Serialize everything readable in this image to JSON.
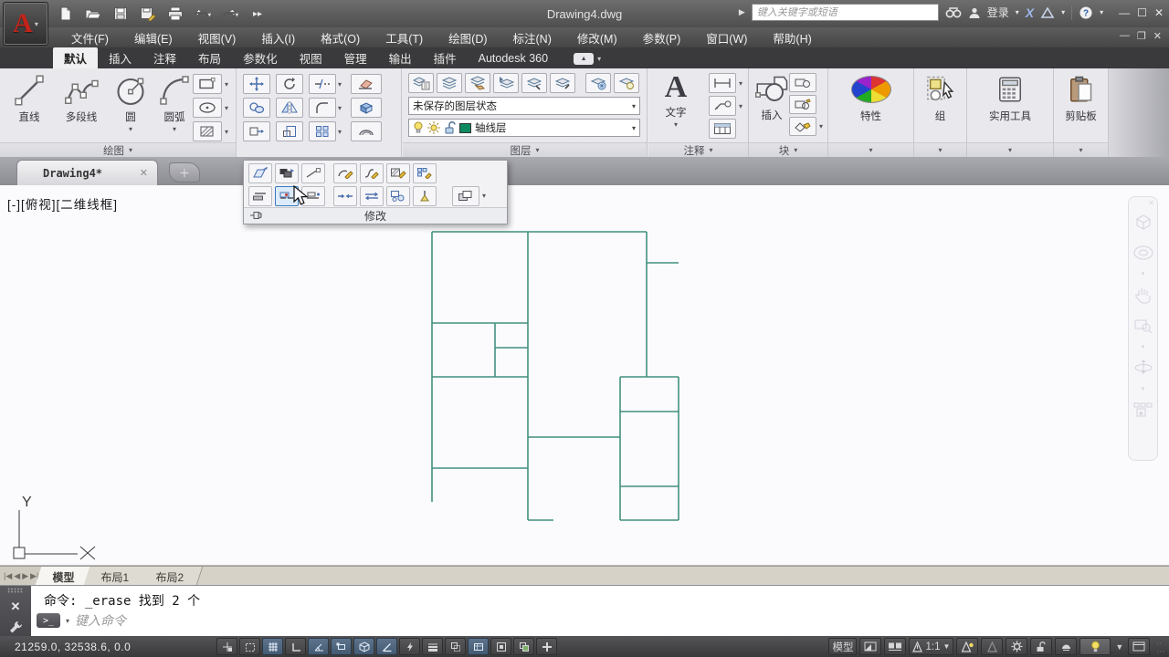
{
  "titlebar": {
    "title": "Drawing4.dwg",
    "search_placeholder": "键入关键字或短语",
    "signin_label": "登录",
    "quick_access_icons": [
      "new-file-icon",
      "open-file-icon",
      "save-icon",
      "save-as-icon",
      "plot-icon",
      "undo-icon",
      "redo-icon",
      "more-tools-icon"
    ],
    "window_controls": [
      "minimize",
      "maximize",
      "close"
    ]
  },
  "menubar": {
    "items": [
      "文件(F)",
      "编辑(E)",
      "视图(V)",
      "插入(I)",
      "格式(O)",
      "工具(T)",
      "绘图(D)",
      "标注(N)",
      "修改(M)",
      "参数(P)",
      "窗口(W)",
      "帮助(H)"
    ]
  },
  "ribbon": {
    "tabs": [
      "默认",
      "插入",
      "注释",
      "布局",
      "参数化",
      "视图",
      "管理",
      "输出",
      "插件",
      "Autodesk 360"
    ],
    "active_tab": "默认",
    "panels": {
      "draw": {
        "title": "绘图",
        "tools": [
          {
            "label": "直线"
          },
          {
            "label": "多段线"
          },
          {
            "label": "圆"
          },
          {
            "label": "圆弧"
          }
        ]
      },
      "modify": {
        "title": "修改"
      },
      "layers": {
        "title": "图层",
        "layer_state": "未保存的图层状态",
        "current_layer": "轴线层",
        "layer_color": "#0e8a62"
      },
      "annotation": {
        "title": "注释",
        "text_tool": "文字"
      },
      "block": {
        "title": "块",
        "insert_tool": "插入"
      },
      "properties": {
        "title": "特性"
      },
      "groups": {
        "title": "组"
      },
      "utilities": {
        "title": "实用工具"
      },
      "clipboard": {
        "title": "剪贴板"
      }
    }
  },
  "modify_flyout": {
    "label": "修改"
  },
  "file_tab": {
    "label": "Drawing4*"
  },
  "viewport_label": "[-][俯视][二维线框]",
  "drawing": {
    "stroke_color": "#43907e",
    "lines": [
      [
        473,
        51,
        708,
        51
      ],
      [
        473,
        51,
        473,
        347
      ],
      [
        578,
        51,
        578,
        367
      ],
      [
        708,
        51,
        708,
        210
      ],
      [
        708,
        85,
        743,
        85
      ],
      [
        473,
        151,
        578,
        151
      ],
      [
        542,
        151,
        542,
        210
      ],
      [
        542,
        178,
        578,
        178
      ],
      [
        473,
        210,
        578,
        210
      ],
      [
        578,
        276,
        679,
        276
      ],
      [
        473,
        310,
        578,
        310
      ],
      [
        679,
        210,
        743,
        210
      ],
      [
        679,
        210,
        679,
        367
      ],
      [
        743,
        210,
        743,
        367
      ],
      [
        679,
        248,
        743,
        248
      ],
      [
        679,
        330,
        743,
        330
      ],
      [
        679,
        367,
        743,
        367
      ],
      [
        578,
        367,
        606,
        367
      ]
    ]
  },
  "layout_tabs": {
    "items": [
      "模型",
      "布局1",
      "布局2"
    ],
    "active": "模型"
  },
  "command": {
    "history": "命令: _erase 找到 2 个",
    "placeholder": "键入命令"
  },
  "status_bar": {
    "coordinates": "21259.0, 32538.6, 0.0",
    "toggles": [
      {
        "name": "infer-constraints",
        "pressed": false
      },
      {
        "name": "snap-mode",
        "pressed": false
      },
      {
        "name": "grid-display",
        "pressed": true
      },
      {
        "name": "ortho-mode",
        "pressed": false
      },
      {
        "name": "polar-tracking",
        "pressed": true
      },
      {
        "name": "object-snap",
        "pressed": true
      },
      {
        "name": "3d-object-snap",
        "pressed": true
      },
      {
        "name": "dynamic-ucs",
        "pressed": true
      },
      {
        "name": "dynamic-input",
        "pressed": false
      },
      {
        "name": "lineweight",
        "pressed": false
      },
      {
        "name": "transparency",
        "pressed": false
      },
      {
        "name": "quick-properties",
        "pressed": true
      },
      {
        "name": "annotation-monitor",
        "pressed": false
      },
      {
        "name": "selection-cycling",
        "pressed": false
      },
      {
        "name": "add-annotation",
        "pressed": false
      }
    ],
    "model_label": "模型",
    "annotation_scale": "1:1"
  }
}
